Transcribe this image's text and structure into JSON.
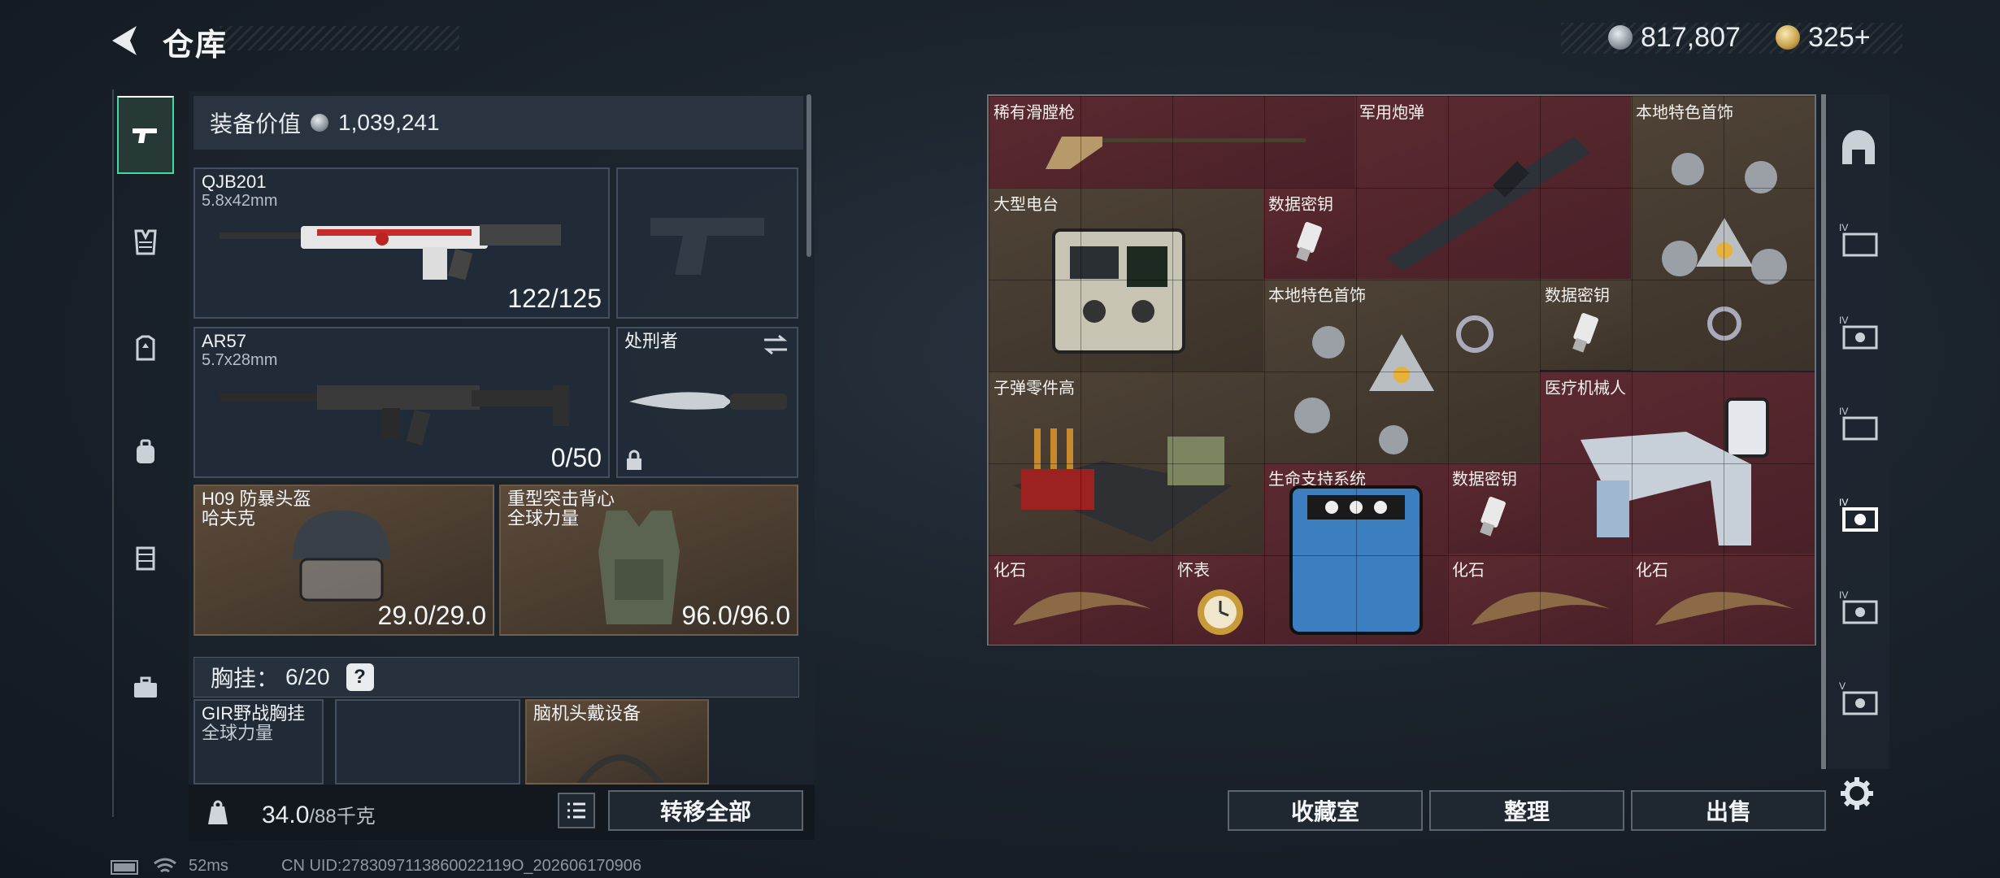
{
  "header": {
    "title": "仓库"
  },
  "currency": {
    "silver_amount": "817,807",
    "gold_amount": "325+"
  },
  "equipment": {
    "value_label": "装备价值",
    "value_amount": "1,039,241",
    "primary_weapon": {
      "name": "QJB201",
      "caliber": "5.8x42mm",
      "ammo": "122/125"
    },
    "secondary_weapon": {
      "name": "AR57",
      "caliber": "5.7x28mm",
      "ammo": "0/50"
    },
    "melee": {
      "name": "处刑者"
    },
    "helmet": {
      "name": "H09 防暴头盔",
      "brand": "哈夫克",
      "durability": "29.0/29.0"
    },
    "armor": {
      "name": "重型突击背心",
      "brand": "全球力量",
      "durability": "96.0/96.0"
    },
    "chest_rig": {
      "label": "胸挂：",
      "capacity": "6/20",
      "help": "?"
    },
    "rig_item": {
      "name": "GIR野战胸挂",
      "brand": "全球力量"
    },
    "headgear_item": {
      "name": "脑机头戴设备"
    },
    "weight": {
      "current": "34.0",
      "max": "/88千克"
    },
    "transfer_all_label": "转移全部"
  },
  "storage": {
    "items": [
      {
        "id": "musket",
        "label": "稀有滑膛枪",
        "tone": "red"
      },
      {
        "id": "shell",
        "label": "军用炮弹",
        "tone": "red"
      },
      {
        "id": "necklace1",
        "label": "本地特色首饰",
        "tone": "brown"
      },
      {
        "id": "radio",
        "label": "大型电台",
        "tone": "brown"
      },
      {
        "id": "key1",
        "label": "数据密钥",
        "tone": "red"
      },
      {
        "id": "necklace2",
        "label": "本地特色首饰",
        "tone": "brown"
      },
      {
        "id": "key2",
        "label": "数据密钥",
        "tone": "brown"
      },
      {
        "id": "bullet_parts",
        "label": "子弹零件高",
        "tone": "brown"
      },
      {
        "id": "robot",
        "label": "医疗机械人",
        "tone": "red"
      },
      {
        "id": "life_support",
        "label": "生命支持系统",
        "tone": "red"
      },
      {
        "id": "key3",
        "label": "数据密钥",
        "tone": "red"
      },
      {
        "id": "fossil1",
        "label": "化石",
        "tone": "red"
      },
      {
        "id": "watch",
        "label": "怀表",
        "tone": "red"
      },
      {
        "id": "fossil2",
        "label": "化石",
        "tone": "red"
      },
      {
        "id": "fossil3",
        "label": "化石",
        "tone": "red"
      }
    ],
    "buttons": {
      "collection": "收藏室",
      "sort": "整理",
      "sell": "出售"
    }
  },
  "status_bar": {
    "latency": "52ms",
    "uid": "CN UID:2783097113860022119O_202606170906"
  },
  "colors": {
    "accent": "#43d9a0",
    "red_cell": "#5b2a30",
    "brown_cell": "#4f4336"
  },
  "icons": {
    "back": "chevron-left-icon",
    "rail": [
      "pistol-icon",
      "vest-icon",
      "armor-plate-icon",
      "backpack-icon",
      "rig-icon",
      "briefcase-icon"
    ],
    "right_rail": [
      "safehouse-icon",
      "folder-iv-icon",
      "stash-iv-a-icon",
      "folder-iv-b-icon",
      "stash-iv-active-icon",
      "stash-iv-c-icon",
      "stash-v-icon",
      "settings-icon"
    ]
  }
}
